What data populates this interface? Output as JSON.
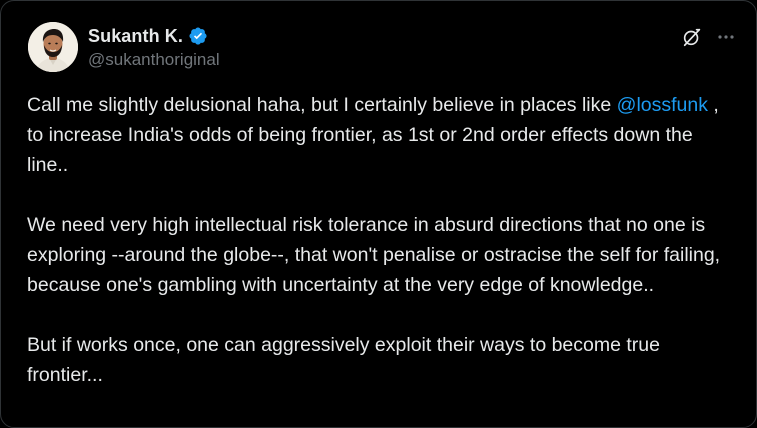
{
  "author": {
    "display_name": "Sukanth K.",
    "handle": "@sukanthoriginal",
    "verified": true,
    "verified_icon": "verified-badge-icon",
    "avatar_icon": "profile-avatar"
  },
  "actions": {
    "grok_icon": "grok-icon",
    "more_icon": "more-options-icon"
  },
  "colors": {
    "background": "#000000",
    "text": "#e7e9ea",
    "secondary_text": "#71767b",
    "link": "#1d9bf0",
    "verified": "#1d9bf0"
  },
  "post": {
    "p1_before": "Call me slightly delusional haha, but I certainly believe in places like ",
    "mention": "@lossfunk",
    "p1_after": " , to increase India's odds of being frontier, as 1st or 2nd order effects down the line..",
    "p2": "We need very high intellectual risk tolerance in absurd directions that no one is exploring --around the globe--, that won't penalise or ostracise the self for failing, because one's gambling with uncertainty at the very edge of knowledge..",
    "p3": "But if works once, one can aggressively exploit their ways to become true frontier..."
  }
}
